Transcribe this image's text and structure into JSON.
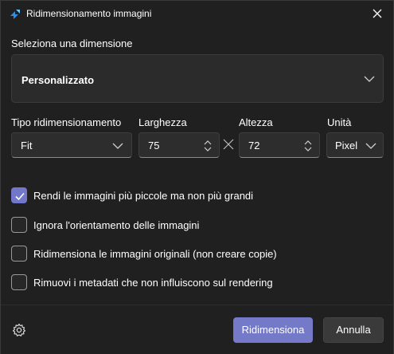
{
  "window": {
    "title": "Ridimensionamento immagini",
    "app_icon": "image-resize-icon",
    "close_icon": "close-icon"
  },
  "dimension": {
    "label": "Seleziona una dimensione",
    "selected": "Personalizzato"
  },
  "resize": {
    "type_label": "Tipo ridimensionamento",
    "type_value": "Fit",
    "width_label": "Larghezza",
    "width_value": "75",
    "height_label": "Altezza",
    "height_value": "72",
    "unit_label": "Unità",
    "unit_value": "Pixel"
  },
  "options": [
    {
      "label": "Rendi le immagini più piccole ma non più grandi",
      "checked": true
    },
    {
      "label": "Ignora l'orientamento delle immagini",
      "checked": false
    },
    {
      "label": "Ridimensiona le immagini originali (non creare copie)",
      "checked": false
    },
    {
      "label": "Rimuovi i metadati che non influiscono sul rendering",
      "checked": false
    }
  ],
  "footer": {
    "settings_icon": "gear-icon",
    "primary_label": "Ridimensiona",
    "secondary_label": "Annulla"
  },
  "colors": {
    "accent": "#7479c8",
    "background": "#202020"
  }
}
